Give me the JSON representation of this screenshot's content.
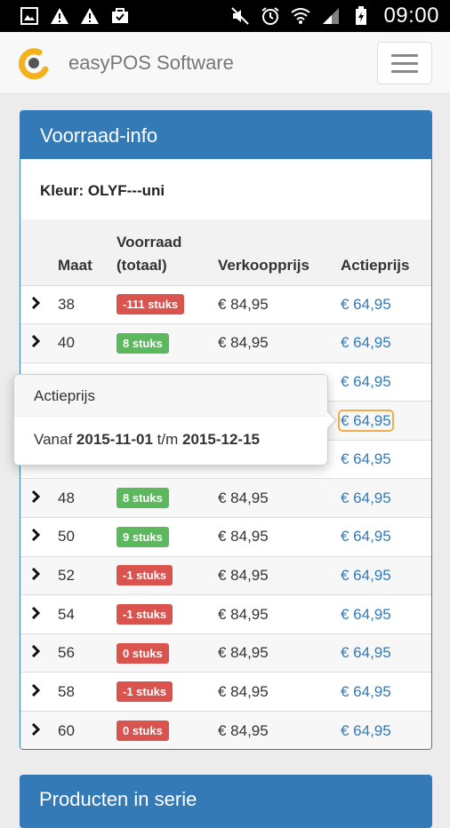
{
  "status_bar": {
    "time": "09:00",
    "icons_left": [
      "image-icon",
      "warning-icon",
      "warning-icon",
      "briefcase-icon"
    ],
    "icons_right": [
      "mute-icon",
      "alarm-icon",
      "wifi-icon",
      "signal-icon",
      "battery-icon"
    ]
  },
  "navbar": {
    "brand": "easyPOS Software",
    "logo": "easypos-logo",
    "menu_icon": "hamburger-icon",
    "colors": {
      "logo_orange": "#f3b21b",
      "logo_gray": "#555555"
    }
  },
  "voorraad_panel": {
    "title": "Voorraad-info",
    "kleur_label": "Kleur:",
    "kleur_value": "OLYF---uni",
    "columns": {
      "maat": "Maat",
      "voorraad_line1": "Voorraad",
      "voorraad_line2": "(totaal)",
      "verkoopprijs": "Verkoopprijs",
      "actieprijs": "Actieprijs"
    },
    "rows": [
      {
        "maat": "38",
        "voorraad": "-111 stuks",
        "status": "red",
        "verkoopprijs": "€ 84,95",
        "actieprijs": "€ 64,95"
      },
      {
        "maat": "40",
        "voorraad": "8 stuks",
        "status": "green",
        "verkoopprijs": "€ 84,95",
        "actieprijs": "€ 64,95"
      },
      {
        "maat": "",
        "voorraad": "",
        "status": "green",
        "verkoopprijs": "",
        "actieprijs": "€ 64,95"
      },
      {
        "maat": "",
        "voorraad": "",
        "status": "none",
        "verkoopprijs": "",
        "actieprijs": "€ 64,95"
      },
      {
        "maat": "",
        "voorraad": "",
        "status": "red",
        "verkoopprijs": "",
        "actieprijs": "€ 64,95"
      },
      {
        "maat": "48",
        "voorraad": "8 stuks",
        "status": "green",
        "verkoopprijs": "€ 84,95",
        "actieprijs": "€ 64,95"
      },
      {
        "maat": "50",
        "voorraad": "9 stuks",
        "status": "green",
        "verkoopprijs": "€ 84,95",
        "actieprijs": "€ 64,95"
      },
      {
        "maat": "52",
        "voorraad": "-1 stuks",
        "status": "red",
        "verkoopprijs": "€ 84,95",
        "actieprijs": "€ 64,95"
      },
      {
        "maat": "54",
        "voorraad": "-1 stuks",
        "status": "red",
        "verkoopprijs": "€ 84,95",
        "actieprijs": "€ 64,95"
      },
      {
        "maat": "56",
        "voorraad": "0 stuks",
        "status": "red",
        "verkoopprijs": "€ 84,95",
        "actieprijs": "€ 64,95"
      },
      {
        "maat": "58",
        "voorraad": "-1 stuks",
        "status": "red",
        "verkoopprijs": "€ 84,95",
        "actieprijs": "€ 64,95"
      },
      {
        "maat": "60",
        "voorraad": "0 stuks",
        "status": "red",
        "verkoopprijs": "€ 84,95",
        "actieprijs": "€ 64,95"
      }
    ],
    "colors": {
      "heading": "#337ab7",
      "link": "#337ab7",
      "label_red": "#d9534f",
      "label_green": "#5cb85c"
    }
  },
  "popover": {
    "title": "Actieprijs",
    "vanaf": "Vanaf",
    "start_date": "2015-11-01",
    "tm": "t/m",
    "end_date": "2015-12-15"
  },
  "next_panel": {
    "title": "Producten in serie"
  }
}
